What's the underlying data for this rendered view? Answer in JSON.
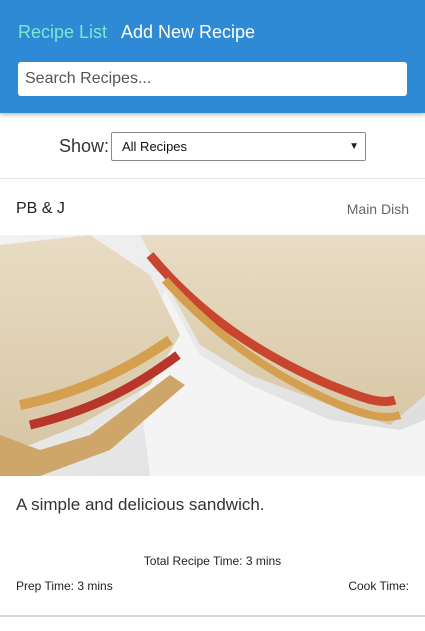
{
  "header": {
    "nav": [
      {
        "label": "Recipe List",
        "active": true
      },
      {
        "label": "Add New Recipe",
        "active": false
      }
    ],
    "search_placeholder": "Search Recipes..."
  },
  "filter": {
    "label": "Show:",
    "selected": "All Recipes"
  },
  "recipe": {
    "title": "PB & J",
    "category": "Main Dish",
    "image_alt": "peanut-butter-and-jelly-sandwich-photo",
    "description": "A simple and delicious sandwich.",
    "total_time": "Total Recipe Time: 3 mins",
    "prep_time": "Prep Time: 3 mins",
    "cook_time": "Cook Time:"
  },
  "colors": {
    "header_bg": "#2f8ad6",
    "active_nav": "#7fe6d0",
    "nav_text": "#ffffff"
  }
}
